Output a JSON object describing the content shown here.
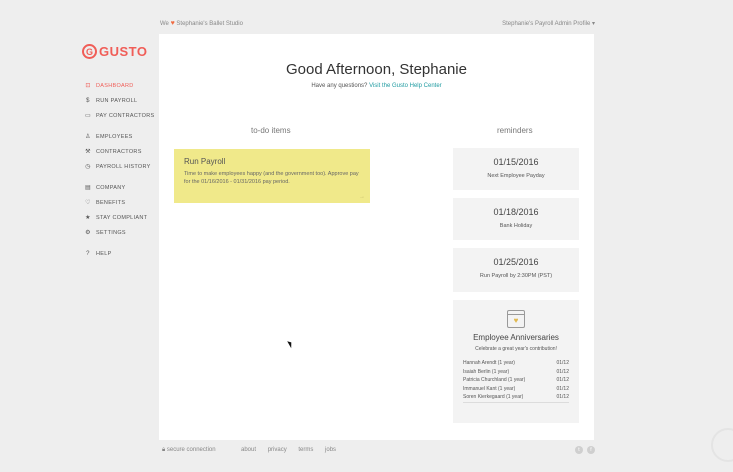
{
  "topbar": {
    "we_prefix": "We",
    "heart_icon": "heart-icon",
    "company": "Stephanie's Ballet Studio",
    "profile": "Stephanie's Payroll Admin Profile ▾"
  },
  "brand": {
    "name": "GUSTO",
    "mark": "G",
    "color": "#f05d57"
  },
  "sidebar": {
    "items": [
      {
        "label": "Dashboard",
        "icon": "dashboard-icon",
        "glyph": "⊡",
        "active": true
      },
      {
        "label": "Run Payroll",
        "icon": "payroll-icon",
        "glyph": "$"
      },
      {
        "label": "Pay Contractors",
        "icon": "money-icon",
        "glyph": "▭"
      },
      {
        "label": "Employees",
        "icon": "person-icon",
        "glyph": "♙"
      },
      {
        "label": "Contractors",
        "icon": "wrench-icon",
        "glyph": "⚒"
      },
      {
        "label": "Payroll History",
        "icon": "history-icon",
        "glyph": "◷"
      },
      {
        "label": "Company",
        "icon": "building-icon",
        "glyph": "▤"
      },
      {
        "label": "Benefits",
        "icon": "heart-outline-icon",
        "glyph": "♡"
      },
      {
        "label": "Stay Compliant",
        "icon": "star-icon",
        "glyph": "★"
      },
      {
        "label": "Settings",
        "icon": "gear-icon",
        "glyph": "⚙"
      },
      {
        "label": "Help",
        "icon": "help-icon",
        "glyph": "?"
      }
    ]
  },
  "main": {
    "greeting": "Good Afternoon, Stephanie",
    "question": "Have any questions?",
    "help_link": "Visit the Gusto Help Center",
    "todo_heading": "to-do items",
    "reminders_heading": "reminders",
    "todo": {
      "title": "Run Payroll",
      "text": "Time to make employees happy (and the government too). Approve pay for the 01/16/2016 - 01/31/2016 pay period.",
      "arrow": "→",
      "color": "#f0e98a"
    },
    "reminders": [
      {
        "date": "01/15/2016",
        "label": "Next Employee Payday"
      },
      {
        "date": "01/18/2016",
        "label": "Bank Holiday"
      },
      {
        "date": "01/25/2016",
        "label": "Run Payroll by 2:30PM (PST)"
      }
    ],
    "anniversaries": {
      "icon": "calendar-heart-icon",
      "title": "Employee Anniversaries",
      "subtitle": "Celebrate a great year's contribution!",
      "rows": [
        {
          "name": "Hannah Arendt (1 year)",
          "date": "01/12"
        },
        {
          "name": "Isaiah Berlin (1 year)",
          "date": "01/12"
        },
        {
          "name": "Patricia Churchland (1 year)",
          "date": "01/12"
        },
        {
          "name": "Immanuel Kant (1 year)",
          "date": "01/12"
        },
        {
          "name": "Soren Kierkegaard (1 year)",
          "date": "01/12"
        }
      ]
    }
  },
  "footer": {
    "secure": "secure connection",
    "lock_icon": "lock-icon",
    "links": [
      "about",
      "privacy",
      "terms",
      "jobs"
    ],
    "social": [
      {
        "icon": "twitter-icon",
        "glyph": "t"
      },
      {
        "icon": "facebook-icon",
        "glyph": "f"
      }
    ]
  }
}
